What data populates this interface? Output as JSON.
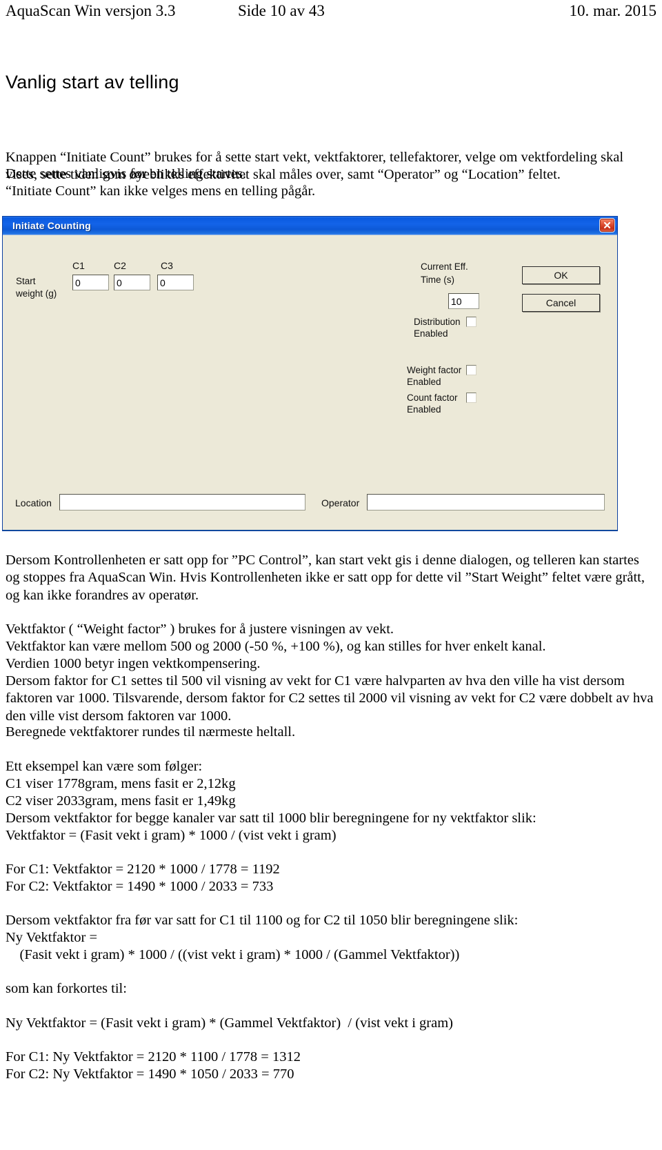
{
  "header": {
    "left": "AquaScan Win versjon 3.3",
    "middle": "Side 10 av 43",
    "right": "10. mar. 2015"
  },
  "section_title": "Vanlig start av telling",
  "intro_paragraph": "Knappen “Initiate Count” brukes for å sette start vekt, vektfaktorer, tellefaktorer, velge om vektfordeling skal vises, sette tiden som øyeblikks effektivitet skal måles over, samt “Operator” og “Location” feltet.",
  "intro_line_2": "Dette settes vanligvis før en telling startes.",
  "intro_line_3": "“Initiate Count” kan ikke velges mens en telling pågår.",
  "dialog": {
    "title": "Initiate Counting",
    "close_label": "Close",
    "start_weight_label": "Start\nweight (g)",
    "channels": [
      {
        "header": "C1",
        "value": "0"
      },
      {
        "header": "C2",
        "value": "0"
      },
      {
        "header": "C3",
        "value": "0"
      }
    ],
    "current_eff_label": "Current Eff.\nTime (s)",
    "current_eff_value": "10",
    "checkboxes": [
      {
        "label": "Distribution\nEnabled",
        "checked": false
      },
      {
        "label": "Weight factor\nEnabled",
        "checked": false
      },
      {
        "label": "Count factor\nEnabled",
        "checked": false
      }
    ],
    "ok_label": "OK",
    "cancel_label": "Cancel",
    "location_label": "Location",
    "location_value": "",
    "operator_label": "Operator",
    "operator_value": ""
  },
  "body": {
    "p1": "Dersom Kontrollenheten er satt opp for ”PC Control”, kan start vekt gis i denne dialogen, og telleren kan startes og stoppes fra AquaScan Win. Hvis Kontrollenheten ikke er satt opp for dette vil ”Start Weight” feltet være grått, og kan ikke forandres av operatør.",
    "p2_l1": "Vektfaktor ( “Weight factor” ) brukes for å justere visningen av vekt.",
    "p2_l2": "Vektfaktor kan være mellom 500 og 2000 (-50 %, +100 %), og kan stilles for hver enkelt kanal.",
    "p2_l3": "Verdien 1000 betyr ingen vektkompensering.",
    "p2_l4": "Dersom faktor for C1 settes til 500 vil visning av vekt for C1 være halvparten av hva den ville ha vist dersom faktoren var 1000. Tilsvarende, dersom faktor for C2 settes til 2000 vil visning av vekt for C2 være dobbelt av hva den ville vist dersom faktoren var 1000.",
    "p2_l5": "Beregnede vektfaktorer rundes til nærmeste heltall.",
    "p3_l1": "Ett eksempel kan være som følger:",
    "p3_l2": "C1 viser 1778gram, mens fasit er 2,12kg",
    "p3_l3": "C2 viser 2033gram, mens fasit er 1,49kg",
    "p3_l4": "Dersom vektfaktor for begge kanaler var satt til 1000 blir beregningene for ny vektfaktor slik:",
    "p3_l5": "Vektfaktor = (Fasit vekt i gram) * 1000 / (vist vekt i gram)",
    "p4_l1": "For C1: Vektfaktor = 2120 * 1000 / 1778 = 1192",
    "p4_l2": "For C2: Vektfaktor = 1490 * 1000 / 2033 = 733",
    "p5_l1": "Dersom vektfaktor fra før var satt for C1 til 1100 og for C2 til 1050 blir beregningene slik:",
    "p5_l2": "Ny Vektfaktor =",
    "p5_l3": "    (Fasit vekt i gram) * 1000 / ((vist vekt i gram) * 1000 / (Gammel Vektfaktor))",
    "p6": "som kan forkortes til:",
    "p7": "Ny Vektfaktor = (Fasit vekt i gram) * (Gammel Vektfaktor)  / (vist vekt i gram)",
    "p8_l1": "For C1: Ny Vektfaktor = 2120 * 1100 / 1778 = 1312",
    "p8_l2": "For C2: Ny Vektfaktor = 1490 * 1050 / 2033 = 770"
  },
  "colors": {
    "titlebar_blue": "#0d59d6",
    "dialog_face": "#ece9d8",
    "close_red": "#c62f17"
  }
}
